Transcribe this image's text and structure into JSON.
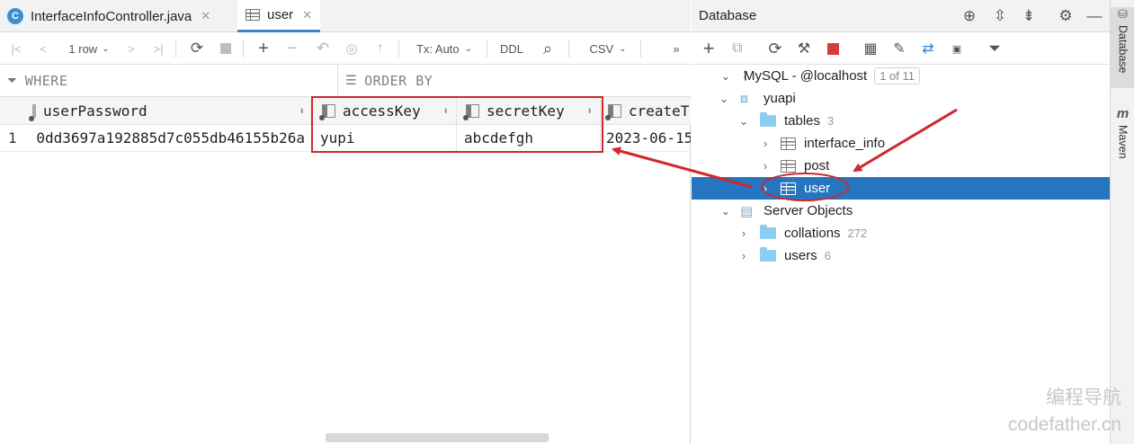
{
  "editor_tabs": [
    {
      "icon": "C",
      "label": "InterfaceInfoController.java",
      "close": "✕"
    },
    {
      "label": "user",
      "close": "✕"
    }
  ],
  "toolbar": {
    "rows": "1 row",
    "tx": "Tx: Auto",
    "ddl": "DDL",
    "csv": "CSV",
    "more": "»"
  },
  "filter": {
    "where": "WHERE",
    "order_by": "ORDER BY"
  },
  "grid": {
    "columns": [
      "userPassword",
      "accessKey",
      "secretKey",
      "createT"
    ],
    "rows": [
      {
        "num": "1",
        "cells": [
          "0dd3697a192885d7c055db46155b26a",
          "yupi",
          "abcdefgh",
          "2023-06-15"
        ]
      }
    ]
  },
  "database_panel": {
    "title": "Database",
    "tree": {
      "connection": {
        "label": "MySQL - @localhost",
        "badge": "1 of 11"
      },
      "schema": "yuapi",
      "tables": {
        "label": "tables",
        "count": "3"
      },
      "table_items": [
        "interface_info",
        "post",
        "user"
      ],
      "server_objects": "Server Objects",
      "collations": {
        "label": "collations",
        "count": "272"
      },
      "users": {
        "label": "users",
        "count": "6"
      }
    }
  },
  "side_strip": {
    "database": "Database",
    "maven": "Maven",
    "maven_icon": "m"
  },
  "watermark": {
    "line1": "编程导航",
    "line2": "codefather.cn"
  },
  "colors": {
    "selection": "#2675bf",
    "annotation_red": "#d0272b",
    "folder": "#8ecdf2"
  }
}
